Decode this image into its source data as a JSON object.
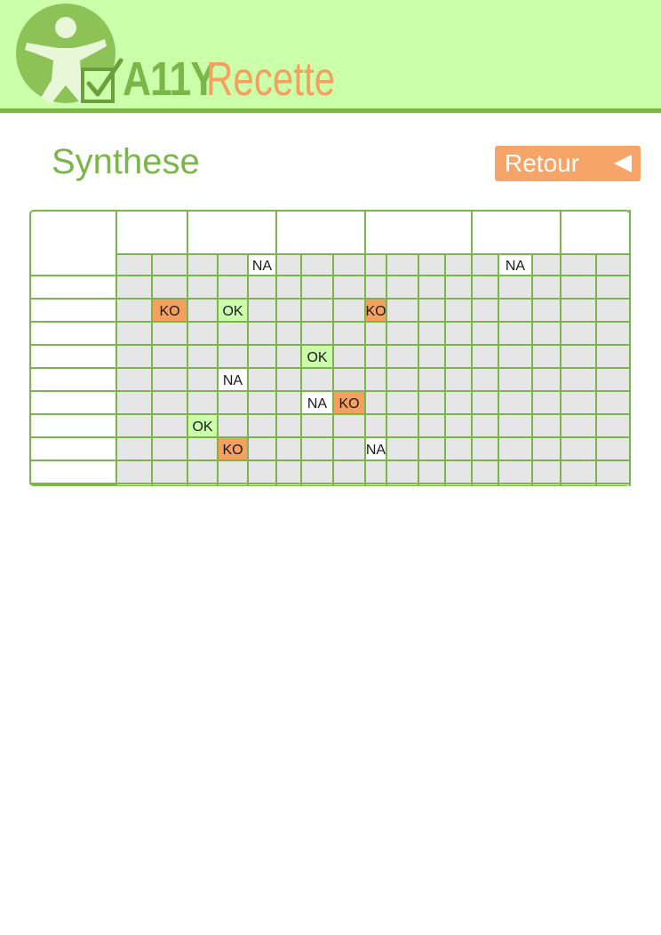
{
  "header": {
    "logo_a11y": "A11Y",
    "logo_recette": "Recette",
    "icon": "accessibility-person-icon",
    "check_icon": "checkbox-check-icon"
  },
  "page": {
    "title": "Synthese",
    "back_label": "Retour",
    "back_icon": "triangle-left-icon"
  },
  "colors": {
    "header_bg": "#ccffaa",
    "brand_green": "#7ab648",
    "brand_orange": "#f5a05f",
    "grid_line": "#7ab648",
    "cell_bg": "#e6e6e6",
    "ok_bg": "#ccffaa",
    "ko_bg": "#f5a05f",
    "na_bg": "#ffffff"
  },
  "grid": {
    "rows": 10,
    "groups": [
      {
        "header": "",
        "cols": 2
      },
      {
        "header": "",
        "cols": 3
      },
      {
        "header": "",
        "cols": 3
      },
      {
        "header": "",
        "cols": 4
      },
      {
        "header": "",
        "cols": 3
      },
      {
        "header": "",
        "cols": 2
      }
    ],
    "row_labels": [
      "",
      "",
      "",
      "",
      "",
      "",
      "",
      "",
      "",
      ""
    ],
    "marks": [
      {
        "row": 0,
        "col": 4,
        "status": "NA"
      },
      {
        "row": 0,
        "col": 13,
        "status": "NA"
      },
      {
        "row": 2,
        "col": 1,
        "status": "KO"
      },
      {
        "row": 2,
        "col": 3,
        "status": "OK"
      },
      {
        "row": 2,
        "col": 8,
        "status": "KO"
      },
      {
        "row": 4,
        "col": 6,
        "status": "OK"
      },
      {
        "row": 5,
        "col": 3,
        "status": "NA"
      },
      {
        "row": 6,
        "col": 6,
        "status": "NA"
      },
      {
        "row": 6,
        "col": 7,
        "status": "KO"
      },
      {
        "row": 7,
        "col": 2,
        "status": "OK"
      },
      {
        "row": 8,
        "col": 3,
        "status": "KO"
      },
      {
        "row": 8,
        "col": 8,
        "status": "NA"
      }
    ]
  }
}
